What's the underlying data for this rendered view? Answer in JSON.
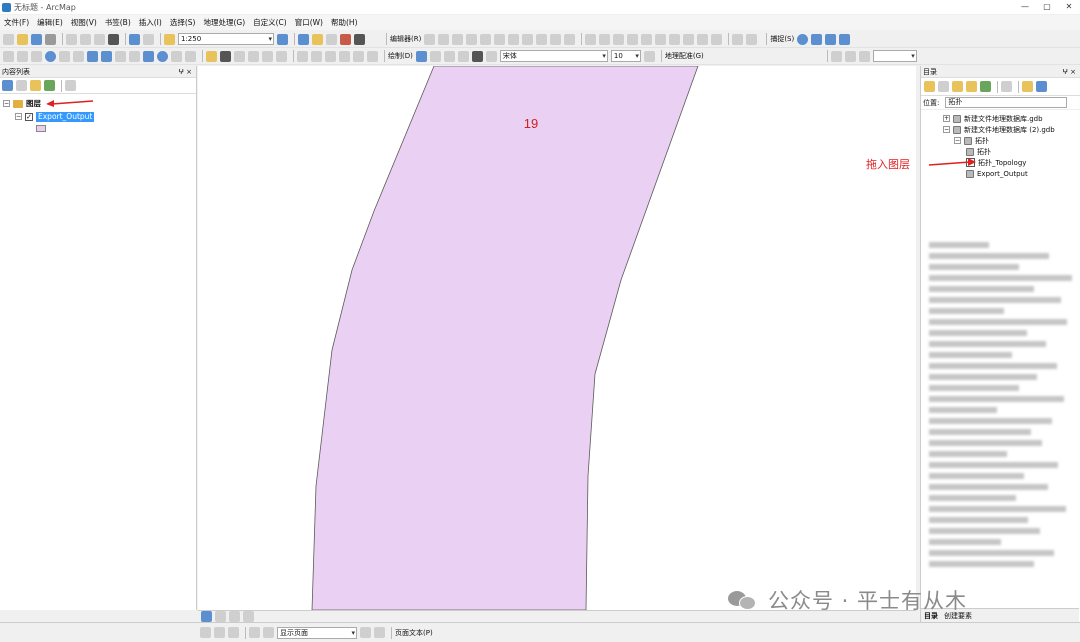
{
  "window": {
    "title": "无标题 - ArcMap",
    "controls": [
      "—",
      "▢",
      "✕"
    ]
  },
  "menu": [
    "文件(F)",
    "编辑(E)",
    "视图(V)",
    "书签(B)",
    "插入(I)",
    "选择(S)",
    "地理处理(G)",
    "自定义(C)",
    "窗口(W)",
    "帮助(H)"
  ],
  "toolbar1": {
    "scale": "1:250",
    "editor_label": "编辑器(R)",
    "snapping_label": "捕捉(S)"
  },
  "toolbar2": {
    "draw_label": "绘制(D)",
    "font_name": "宋体",
    "font_size": "10",
    "georef_label": "地理配准(G)"
  },
  "toc": {
    "title": "内容列表",
    "pin": "ⵖ ×",
    "group_label": "图层",
    "layer_label": "Export_Output",
    "layer_checked": true
  },
  "map": {
    "feature_label": "19",
    "polygon_fill": "#ead0f2",
    "polygon_stroke": "#5a5a5a"
  },
  "map_status": {
    "page_label": "显示页面"
  },
  "bottom": {
    "text_label": "页面文本(P)"
  },
  "catalog": {
    "title": "目录",
    "pin": "ⵖ ×",
    "location_label": "位置:",
    "location_value": "拓扑",
    "items": [
      {
        "label": "新建文件地理数据库.gdb",
        "indent": 0
      },
      {
        "label": "新建文件地理数据库 (2).gdb",
        "indent": 0
      },
      {
        "label": "拓扑",
        "indent": 1
      },
      {
        "label": "拓扑",
        "indent": 2
      },
      {
        "label": "拓扑_Topology",
        "indent": 2
      },
      {
        "label": "Export_Output",
        "indent": 1
      }
    ],
    "tabs": [
      "目录",
      "创建要素"
    ]
  },
  "annotations": {
    "drag_note": "拖入图层"
  },
  "watermark": {
    "text": "公众号 · 平士有从木"
  },
  "colors": {
    "selection": "#3399ff",
    "annotation": "#e02020"
  }
}
